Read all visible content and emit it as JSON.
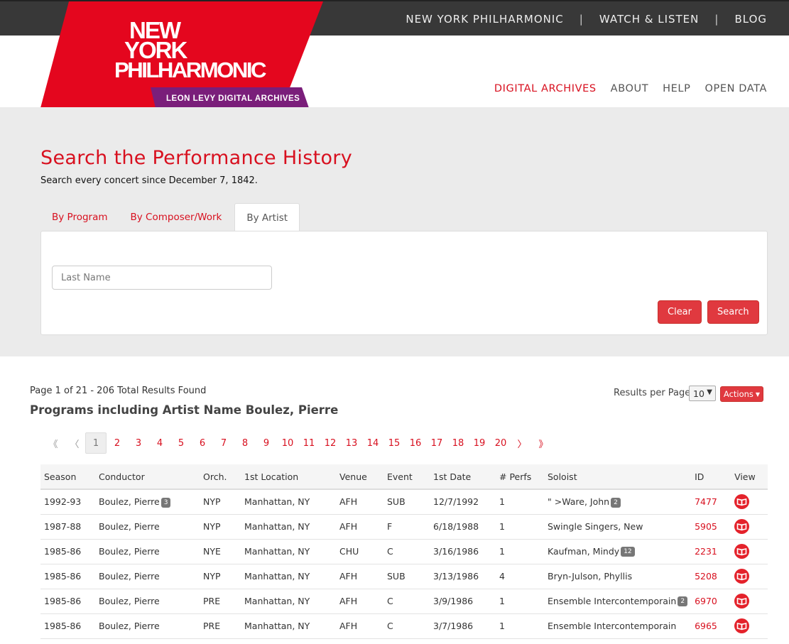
{
  "topnav": {
    "items": [
      "NEW YORK PHILHARMONIC",
      "WATCH & LISTEN",
      "BLOG"
    ],
    "separator": "|"
  },
  "logo": {
    "line1": "NEW",
    "line2": "YORK",
    "line3": "PHILHARMONIC",
    "ribbon": "LEON LEVY DIGITAL ARCHIVES",
    "colors": {
      "red": "#e4061e",
      "purple": "#7a1e7a"
    }
  },
  "mainnav": {
    "items": [
      "DIGITAL ARCHIVES",
      "ABOUT",
      "HELP",
      "OPEN DATA"
    ],
    "active_index": 0
  },
  "search": {
    "title": "Search the Performance History",
    "subtitle": "Search every concert since December 7, 1842.",
    "tabs": [
      "By Program",
      "By Composer/Work",
      "By Artist"
    ],
    "active_tab": "By Artist",
    "last_name_placeholder": "Last Name",
    "clear_label": "Clear",
    "search_label": "Search"
  },
  "results": {
    "count_text": "Page 1 of 21 - 206 Total Results Found",
    "heading": "Programs including Artist Name Boulez, Pierre",
    "rpp_label": "Results per Page",
    "rpp_value": "10",
    "actions_label": "Actions"
  },
  "pagination": {
    "first": "《",
    "prev": "〈",
    "pages": [
      "1",
      "2",
      "3",
      "4",
      "5",
      "6",
      "7",
      "8",
      "9",
      "10",
      "11",
      "12",
      "13",
      "14",
      "15",
      "16",
      "17",
      "18",
      "19",
      "20"
    ],
    "current": "1",
    "next": "〉",
    "last": "》"
  },
  "table": {
    "headers": [
      "Season",
      "Conductor",
      "Orch.",
      "1st Location",
      "Venue",
      "Event",
      "1st Date",
      "# Perfs",
      "Soloist",
      "ID",
      "View"
    ],
    "rows": [
      {
        "season": "1992-93",
        "conductor": "Boulez, Pierre",
        "conductor_badge": "3",
        "orch": "NYP",
        "location": "Manhattan, NY",
        "venue": "AFH",
        "event": "SUB",
        "date": "12/7/1992",
        "perfs": "1",
        "soloist": "\" >Ware, John",
        "soloist_badge": "2",
        "id": "7477"
      },
      {
        "season": "1987-88",
        "conductor": "Boulez, Pierre",
        "conductor_badge": "",
        "orch": "NYP",
        "location": "Manhattan, NY",
        "venue": "AFH",
        "event": "F",
        "date": "6/18/1988",
        "perfs": "1",
        "soloist": "Swingle Singers, New",
        "soloist_badge": "",
        "id": "5905"
      },
      {
        "season": "1985-86",
        "conductor": "Boulez, Pierre",
        "conductor_badge": "",
        "orch": "NYE",
        "location": "Manhattan, NY",
        "venue": "CHU",
        "event": "C",
        "date": "3/16/1986",
        "perfs": "1",
        "soloist": "Kaufman, Mindy",
        "soloist_badge": "12",
        "id": "2231"
      },
      {
        "season": "1985-86",
        "conductor": "Boulez, Pierre",
        "conductor_badge": "",
        "orch": "NYP",
        "location": "Manhattan, NY",
        "venue": "AFH",
        "event": "SUB",
        "date": "3/13/1986",
        "perfs": "4",
        "soloist": "Bryn-Julson, Phyllis",
        "soloist_badge": "",
        "id": "5208"
      },
      {
        "season": "1985-86",
        "conductor": "Boulez, Pierre",
        "conductor_badge": "",
        "orch": "PRE",
        "location": "Manhattan, NY",
        "venue": "AFH",
        "event": "C",
        "date": "3/9/1986",
        "perfs": "1",
        "soloist": "Ensemble Intercontemporain",
        "soloist_badge": "2",
        "id": "6970"
      },
      {
        "season": "1985-86",
        "conductor": "Boulez, Pierre",
        "conductor_badge": "",
        "orch": "PRE",
        "location": "Manhattan, NY",
        "venue": "AFH",
        "event": "C",
        "date": "3/7/1986",
        "perfs": "1",
        "soloist": "Ensemble Intercontemporain",
        "soloist_badge": "",
        "id": "6965"
      }
    ],
    "view_icon": "book-icon"
  }
}
